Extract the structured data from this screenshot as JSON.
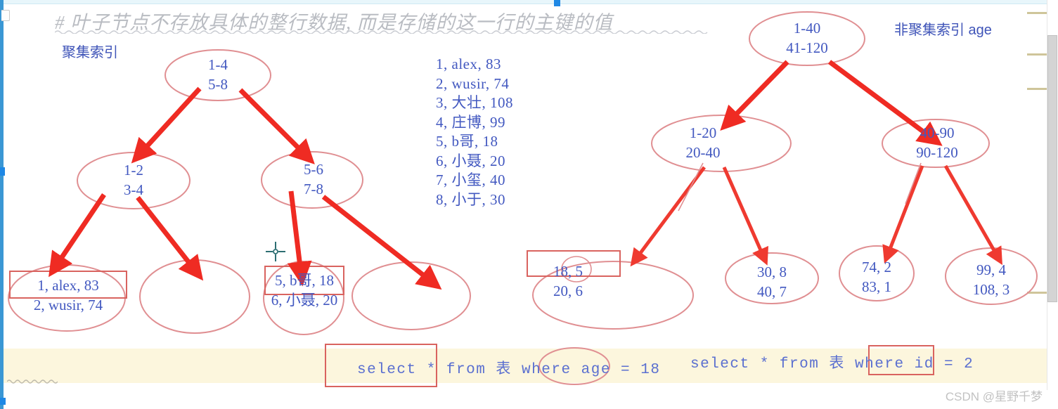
{
  "page": {
    "title_note": "# 叶子节点不存放具体的整行数据, 而是存储的这一行的主键的值",
    "watermark": "CSDN @星野千梦"
  },
  "labels": {
    "clustered_index": "聚集索引",
    "nonclustered_index": "非聚集索引 age"
  },
  "table_rows": [
    "1, alex, 83",
    "2, wusir, 74",
    "3, 大壮, 108",
    "4, 庄博, 99",
    "5, b哥, 18",
    "6, 小聂, 20",
    "7, 小玺, 40",
    "8, 小于, 30"
  ],
  "clustered_tree": {
    "root": {
      "line1": "1-4",
      "line2": "5-8"
    },
    "internal": [
      {
        "line1": "1-2",
        "line2": "3-4"
      },
      {
        "line1": "5-6",
        "line2": "7-8"
      }
    ],
    "leaves": [
      {
        "line1": "1, alex, 83",
        "line2": "2, wusir, 74"
      },
      {
        "line1": "",
        "line2": ""
      },
      {
        "line1": "5, b哥, 18",
        "line2": "6, 小聂, 20"
      },
      {
        "line1": "",
        "line2": ""
      }
    ]
  },
  "nonclustered_tree": {
    "root": {
      "line1": "1-40",
      "line2": "41-120"
    },
    "internal": [
      {
        "line1": "1-20",
        "line2": "20-40"
      },
      {
        "line1": "40-90",
        "line2": "90-120"
      }
    ],
    "leaves": [
      {
        "line1": "18, 5",
        "line2": "20, 6"
      },
      {
        "line1": "30, 8",
        "line2": "40, 7"
      },
      {
        "line1": "74, 2",
        "line2": "83, 1"
      },
      {
        "line1": "99, 4",
        "line2": "108, 3"
      }
    ]
  },
  "queries": {
    "age_query": "select * from 表 where age = 18",
    "id_query": "select * from 表 where id = 2"
  },
  "colors": {
    "node_stroke": "#e08f92",
    "arrow": "#ef2b23",
    "text_blue": "#4258c0",
    "highlight_rect": "#d9635f",
    "band": "#fcf6dd"
  }
}
